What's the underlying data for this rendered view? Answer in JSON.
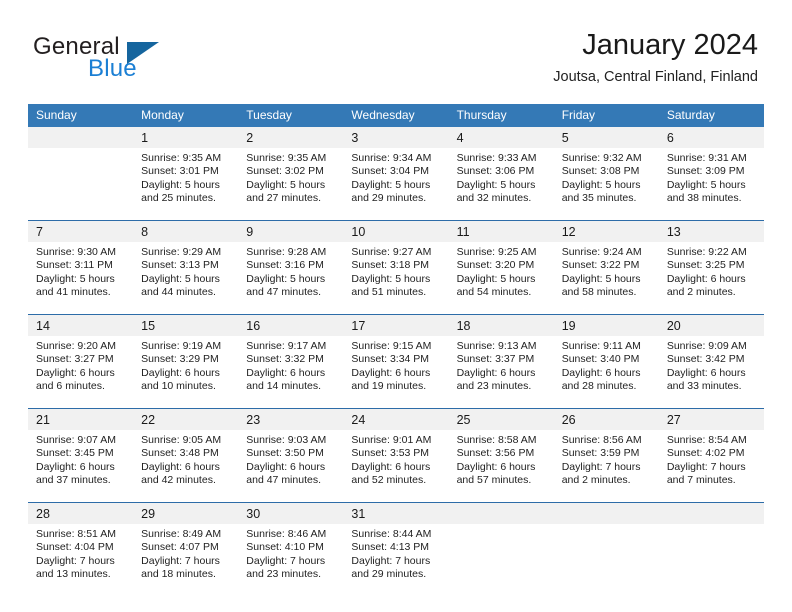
{
  "brand": {
    "word_one": "General",
    "word_two": "Blue",
    "triangle_icon": "triangle-icon",
    "accent_blue": "#1b7fd4",
    "triangle_blue": "#15659e"
  },
  "header": {
    "title": "January 2024",
    "subtitle": "Joutsa, Central Finland, Finland"
  },
  "calendar": {
    "header_bg": "#3479b6",
    "daynum_bg": "#f1f1f1",
    "separator_color": "#2d6ca8",
    "weekday_headers": [
      "Sunday",
      "Monday",
      "Tuesday",
      "Wednesday",
      "Thursday",
      "Friday",
      "Saturday"
    ],
    "weeks": [
      [
        {
          "day": "",
          "sunrise": "",
          "sunset": "",
          "daylight_1": "",
          "daylight_2": ""
        },
        {
          "day": "1",
          "sunrise": "Sunrise: 9:35 AM",
          "sunset": "Sunset: 3:01 PM",
          "daylight_1": "Daylight: 5 hours",
          "daylight_2": "and 25 minutes."
        },
        {
          "day": "2",
          "sunrise": "Sunrise: 9:35 AM",
          "sunset": "Sunset: 3:02 PM",
          "daylight_1": "Daylight: 5 hours",
          "daylight_2": "and 27 minutes."
        },
        {
          "day": "3",
          "sunrise": "Sunrise: 9:34 AM",
          "sunset": "Sunset: 3:04 PM",
          "daylight_1": "Daylight: 5 hours",
          "daylight_2": "and 29 minutes."
        },
        {
          "day": "4",
          "sunrise": "Sunrise: 9:33 AM",
          "sunset": "Sunset: 3:06 PM",
          "daylight_1": "Daylight: 5 hours",
          "daylight_2": "and 32 minutes."
        },
        {
          "day": "5",
          "sunrise": "Sunrise: 9:32 AM",
          "sunset": "Sunset: 3:08 PM",
          "daylight_1": "Daylight: 5 hours",
          "daylight_2": "and 35 minutes."
        },
        {
          "day": "6",
          "sunrise": "Sunrise: 9:31 AM",
          "sunset": "Sunset: 3:09 PM",
          "daylight_1": "Daylight: 5 hours",
          "daylight_2": "and 38 minutes."
        }
      ],
      [
        {
          "day": "7",
          "sunrise": "Sunrise: 9:30 AM",
          "sunset": "Sunset: 3:11 PM",
          "daylight_1": "Daylight: 5 hours",
          "daylight_2": "and 41 minutes."
        },
        {
          "day": "8",
          "sunrise": "Sunrise: 9:29 AM",
          "sunset": "Sunset: 3:13 PM",
          "daylight_1": "Daylight: 5 hours",
          "daylight_2": "and 44 minutes."
        },
        {
          "day": "9",
          "sunrise": "Sunrise: 9:28 AM",
          "sunset": "Sunset: 3:16 PM",
          "daylight_1": "Daylight: 5 hours",
          "daylight_2": "and 47 minutes."
        },
        {
          "day": "10",
          "sunrise": "Sunrise: 9:27 AM",
          "sunset": "Sunset: 3:18 PM",
          "daylight_1": "Daylight: 5 hours",
          "daylight_2": "and 51 minutes."
        },
        {
          "day": "11",
          "sunrise": "Sunrise: 9:25 AM",
          "sunset": "Sunset: 3:20 PM",
          "daylight_1": "Daylight: 5 hours",
          "daylight_2": "and 54 minutes."
        },
        {
          "day": "12",
          "sunrise": "Sunrise: 9:24 AM",
          "sunset": "Sunset: 3:22 PM",
          "daylight_1": "Daylight: 5 hours",
          "daylight_2": "and 58 minutes."
        },
        {
          "day": "13",
          "sunrise": "Sunrise: 9:22 AM",
          "sunset": "Sunset: 3:25 PM",
          "daylight_1": "Daylight: 6 hours",
          "daylight_2": "and 2 minutes."
        }
      ],
      [
        {
          "day": "14",
          "sunrise": "Sunrise: 9:20 AM",
          "sunset": "Sunset: 3:27 PM",
          "daylight_1": "Daylight: 6 hours",
          "daylight_2": "and 6 minutes."
        },
        {
          "day": "15",
          "sunrise": "Sunrise: 9:19 AM",
          "sunset": "Sunset: 3:29 PM",
          "daylight_1": "Daylight: 6 hours",
          "daylight_2": "and 10 minutes."
        },
        {
          "day": "16",
          "sunrise": "Sunrise: 9:17 AM",
          "sunset": "Sunset: 3:32 PM",
          "daylight_1": "Daylight: 6 hours",
          "daylight_2": "and 14 minutes."
        },
        {
          "day": "17",
          "sunrise": "Sunrise: 9:15 AM",
          "sunset": "Sunset: 3:34 PM",
          "daylight_1": "Daylight: 6 hours",
          "daylight_2": "and 19 minutes."
        },
        {
          "day": "18",
          "sunrise": "Sunrise: 9:13 AM",
          "sunset": "Sunset: 3:37 PM",
          "daylight_1": "Daylight: 6 hours",
          "daylight_2": "and 23 minutes."
        },
        {
          "day": "19",
          "sunrise": "Sunrise: 9:11 AM",
          "sunset": "Sunset: 3:40 PM",
          "daylight_1": "Daylight: 6 hours",
          "daylight_2": "and 28 minutes."
        },
        {
          "day": "20",
          "sunrise": "Sunrise: 9:09 AM",
          "sunset": "Sunset: 3:42 PM",
          "daylight_1": "Daylight: 6 hours",
          "daylight_2": "and 33 minutes."
        }
      ],
      [
        {
          "day": "21",
          "sunrise": "Sunrise: 9:07 AM",
          "sunset": "Sunset: 3:45 PM",
          "daylight_1": "Daylight: 6 hours",
          "daylight_2": "and 37 minutes."
        },
        {
          "day": "22",
          "sunrise": "Sunrise: 9:05 AM",
          "sunset": "Sunset: 3:48 PM",
          "daylight_1": "Daylight: 6 hours",
          "daylight_2": "and 42 minutes."
        },
        {
          "day": "23",
          "sunrise": "Sunrise: 9:03 AM",
          "sunset": "Sunset: 3:50 PM",
          "daylight_1": "Daylight: 6 hours",
          "daylight_2": "and 47 minutes."
        },
        {
          "day": "24",
          "sunrise": "Sunrise: 9:01 AM",
          "sunset": "Sunset: 3:53 PM",
          "daylight_1": "Daylight: 6 hours",
          "daylight_2": "and 52 minutes."
        },
        {
          "day": "25",
          "sunrise": "Sunrise: 8:58 AM",
          "sunset": "Sunset: 3:56 PM",
          "daylight_1": "Daylight: 6 hours",
          "daylight_2": "and 57 minutes."
        },
        {
          "day": "26",
          "sunrise": "Sunrise: 8:56 AM",
          "sunset": "Sunset: 3:59 PM",
          "daylight_1": "Daylight: 7 hours",
          "daylight_2": "and 2 minutes."
        },
        {
          "day": "27",
          "sunrise": "Sunrise: 8:54 AM",
          "sunset": "Sunset: 4:02 PM",
          "daylight_1": "Daylight: 7 hours",
          "daylight_2": "and 7 minutes."
        }
      ],
      [
        {
          "day": "28",
          "sunrise": "Sunrise: 8:51 AM",
          "sunset": "Sunset: 4:04 PM",
          "daylight_1": "Daylight: 7 hours",
          "daylight_2": "and 13 minutes."
        },
        {
          "day": "29",
          "sunrise": "Sunrise: 8:49 AM",
          "sunset": "Sunset: 4:07 PM",
          "daylight_1": "Daylight: 7 hours",
          "daylight_2": "and 18 minutes."
        },
        {
          "day": "30",
          "sunrise": "Sunrise: 8:46 AM",
          "sunset": "Sunset: 4:10 PM",
          "daylight_1": "Daylight: 7 hours",
          "daylight_2": "and 23 minutes."
        },
        {
          "day": "31",
          "sunrise": "Sunrise: 8:44 AM",
          "sunset": "Sunset: 4:13 PM",
          "daylight_1": "Daylight: 7 hours",
          "daylight_2": "and 29 minutes."
        },
        {
          "day": "",
          "sunrise": "",
          "sunset": "",
          "daylight_1": "",
          "daylight_2": ""
        },
        {
          "day": "",
          "sunrise": "",
          "sunset": "",
          "daylight_1": "",
          "daylight_2": ""
        },
        {
          "day": "",
          "sunrise": "",
          "sunset": "",
          "daylight_1": "",
          "daylight_2": ""
        }
      ]
    ]
  }
}
